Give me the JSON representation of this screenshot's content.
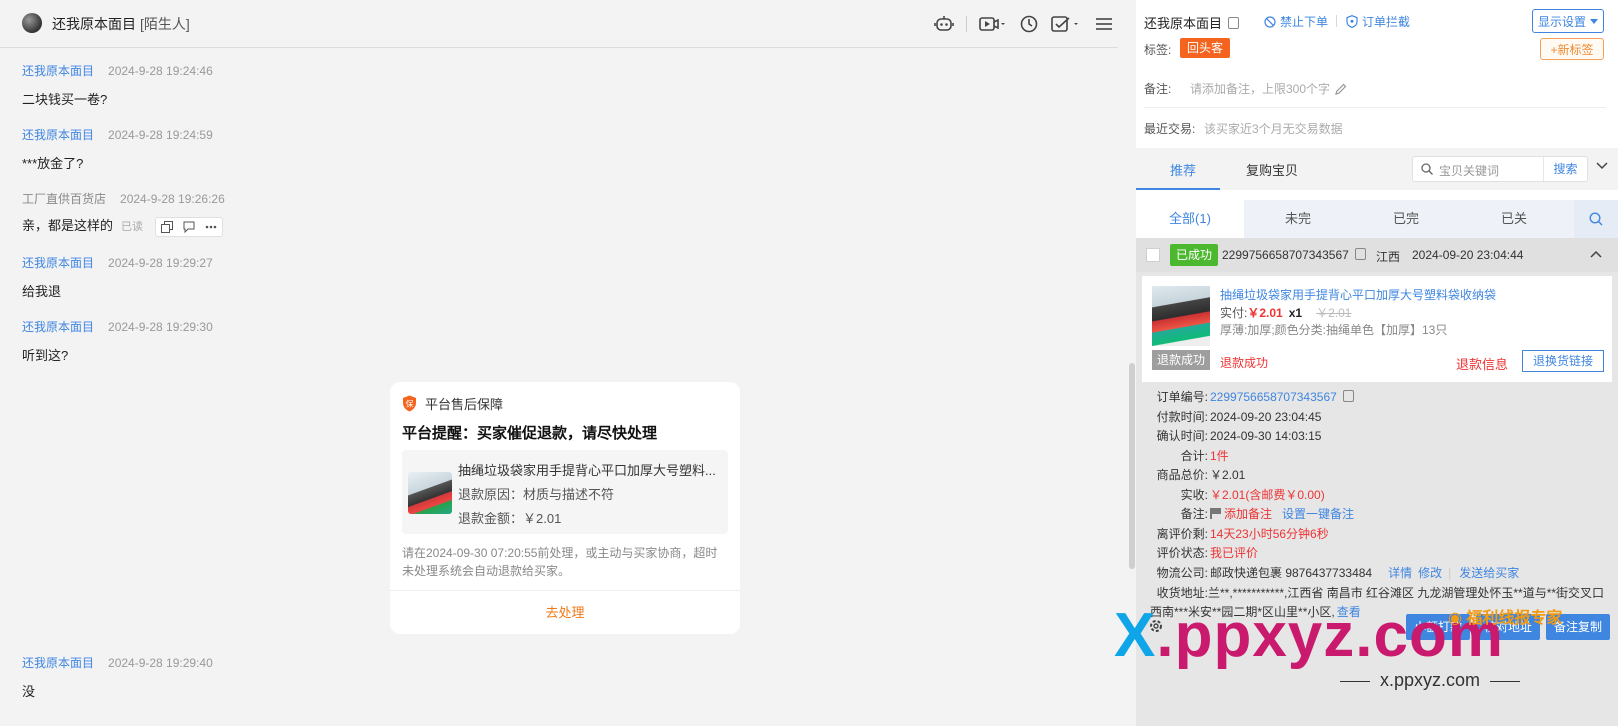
{
  "chat": {
    "header": {
      "name": "还我原本面目",
      "tag": "[陌生人]"
    },
    "messages": [
      {
        "sender": "还我原本面目",
        "time": "2024-9-28 19:24:46",
        "text": "二块钱买一卷?"
      },
      {
        "sender": "还我原本面目",
        "time": "2024-9-28 19:24:59",
        "text": "***放金了?"
      },
      {
        "sender": "工厂直供百货店",
        "time": "2024-9-28 19:26:26",
        "text": "亲，都是这样的",
        "read": "已读"
      },
      {
        "sender": "还我原本面目",
        "time": "2024-9-28 19:29:27",
        "text": "给我退"
      },
      {
        "sender": "还我原本面目",
        "time": "2024-9-28 19:29:30",
        "text": "听到这?"
      },
      {
        "sender": "还我原本面目",
        "time": "2024-9-28 19:29:40",
        "text": "没"
      }
    ],
    "card": {
      "header": "平台售后保障",
      "title": "平台提醒：买家催促退款，请尽快处理",
      "product_name": "抽绳垃圾袋家用手提背心平口加厚大号塑料...",
      "reason": "退款原因：材质与描述不符",
      "amount": "退款金额：￥2.01",
      "note": "请在2024-09-30 07:20:55前处理，或主动与买家协商，超时未处理系统会自动退款给买家。",
      "action": "去处理"
    }
  },
  "sidebar": {
    "buyer_name": "还我原本面目",
    "links": {
      "ban": "禁止下单",
      "intercept": "订单拦截"
    },
    "display_settings": "显示设置",
    "tags_label": "标签:",
    "tag": "回头客",
    "new_tag": "+新标签",
    "remark_label": "备注:",
    "remark_placeholder": "请添加备注，上限300个字",
    "recent_label": "最近交易:",
    "recent_value": "该买家近3个月无交易数据",
    "tabs": [
      "推荐",
      "复购宝贝"
    ],
    "search_placeholder": "宝贝关键词",
    "search_button": "搜索",
    "order_tabs": [
      "全部(1)",
      "未完",
      "已完",
      "已关"
    ]
  },
  "order": {
    "status": "已成功",
    "id": "2299756658707343567",
    "province": "江西",
    "time": "2024-09-20 23:04:44",
    "item": {
      "title": "抽绳垃圾袋家用手提背心平口加厚大号塑料袋收纳袋",
      "paid_label": "实付:",
      "paid": "￥2.01",
      "qty": "x1",
      "orig": "￥2.01",
      "spec": "厚薄:加厚;颜色分类:抽绳单色【加厚】13只",
      "refund_badge": "退款成功",
      "refund_status": "退款成功",
      "refund_info": "退款信息",
      "exchange": "退换货链接"
    },
    "details": [
      {
        "k": "订单编号:",
        "v": "2299756658707343567",
        "style": "blue"
      },
      {
        "k": "付款时间:",
        "v": "2024-09-20 23:04:45",
        "style": ""
      },
      {
        "k": "确认时间:",
        "v": "2024-09-30 14:03:15",
        "style": ""
      },
      {
        "k": "合计:",
        "v": "1件",
        "style": ""
      },
      {
        "k": "商品总价:",
        "v": "￥2.01",
        "style": ""
      },
      {
        "k": "实收:",
        "v": "￥2.01(含邮费￥0.00)",
        "style": "red"
      },
      {
        "k": "备注:",
        "v": "添加备注",
        "v2": "设置一键备注",
        "style": "red"
      },
      {
        "k": "离评价剩:",
        "v": "14天23小时56分钟6秒",
        "style": "red"
      },
      {
        "k": "评价状态:",
        "v": "我已评价",
        "style": "red"
      },
      {
        "k": "物流公司:",
        "v": "邮政快递包裹 9876437733484",
        "v2": "详情",
        "v3": "修改",
        "v4": "发送给买家",
        "style": ""
      }
    ],
    "address_label": "收货地址:",
    "address": "兰**,***********,江西省 南昌市 红谷滩区 九龙湖管理处怀玉**道与**街交叉口西南***米安**园二期*区山里**小区,",
    "address_view": "查看",
    "actions": [
      "小额打款",
      "核对地址",
      "备注复制"
    ]
  },
  "watermark": {
    "main_x": "X",
    "main_rest": ".ppxyz.com",
    "sub": "x.ppxyz.com",
    "badge": "福利线报专家"
  }
}
